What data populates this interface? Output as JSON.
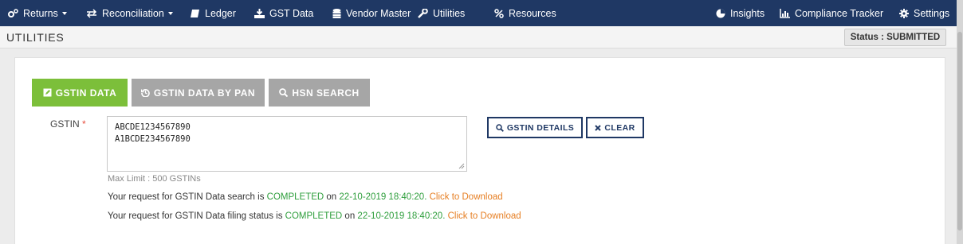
{
  "nav": {
    "items": [
      {
        "label": "Returns",
        "icon": "cogs-icon",
        "dropdown": true
      },
      {
        "label": "Reconciliation",
        "icon": "exchange-icon",
        "dropdown": true
      },
      {
        "label": "Ledger",
        "icon": "book-icon",
        "dropdown": false
      },
      {
        "label": "GST Data",
        "icon": "download-icon",
        "dropdown": false
      },
      {
        "label": "Vendor Master",
        "icon": "database-icon",
        "dropdown": false
      },
      {
        "label": "Utilities",
        "icon": "wrench-icon",
        "dropdown": false
      },
      {
        "label": "Resources",
        "icon": "percent-icon",
        "dropdown": false
      }
    ],
    "right_items": [
      {
        "label": "Insights",
        "icon": "pie-chart-icon"
      },
      {
        "label": "Compliance Tracker",
        "icon": "bar-chart-icon"
      },
      {
        "label": "Settings",
        "icon": "gear-icon"
      }
    ]
  },
  "header": {
    "title": "UTILITIES",
    "status": "Status : SUBMITTED"
  },
  "tabs": [
    {
      "label": "GSTIN DATA",
      "active": true
    },
    {
      "label": "GSTIN DATA BY PAN",
      "active": false
    },
    {
      "label": "HSN SEARCH",
      "active": false
    }
  ],
  "form": {
    "gstin_label": "GSTIN",
    "required_mark": "*",
    "gstin_values": [
      "ABCDE1234567890",
      "A1BCDE234567890"
    ],
    "max_limit": "Max Limit : 500 GSTINs",
    "details_button": "GSTIN DETAILS",
    "clear_button": "CLEAR"
  },
  "messages": [
    {
      "prefix": "Your request for GSTIN Data search is ",
      "status": "COMPLETED",
      "middle": " on ",
      "timestamp": "22-10-2019 18:40:20",
      "dot": ".",
      "link": " Click to Download"
    },
    {
      "prefix": "Your request for GSTIN Data filing status is ",
      "status": "COMPLETED",
      "middle": " on ",
      "timestamp": "22-10-2019 18:40:20",
      "dot": ".",
      "link": " Click to Download"
    }
  ],
  "colors": {
    "nav_bg": "#1f3864",
    "tab_active": "#7cbf3a",
    "tab_inactive": "#a6a6a6",
    "status_ok": "#2e9e3c",
    "link": "#e67e22"
  }
}
